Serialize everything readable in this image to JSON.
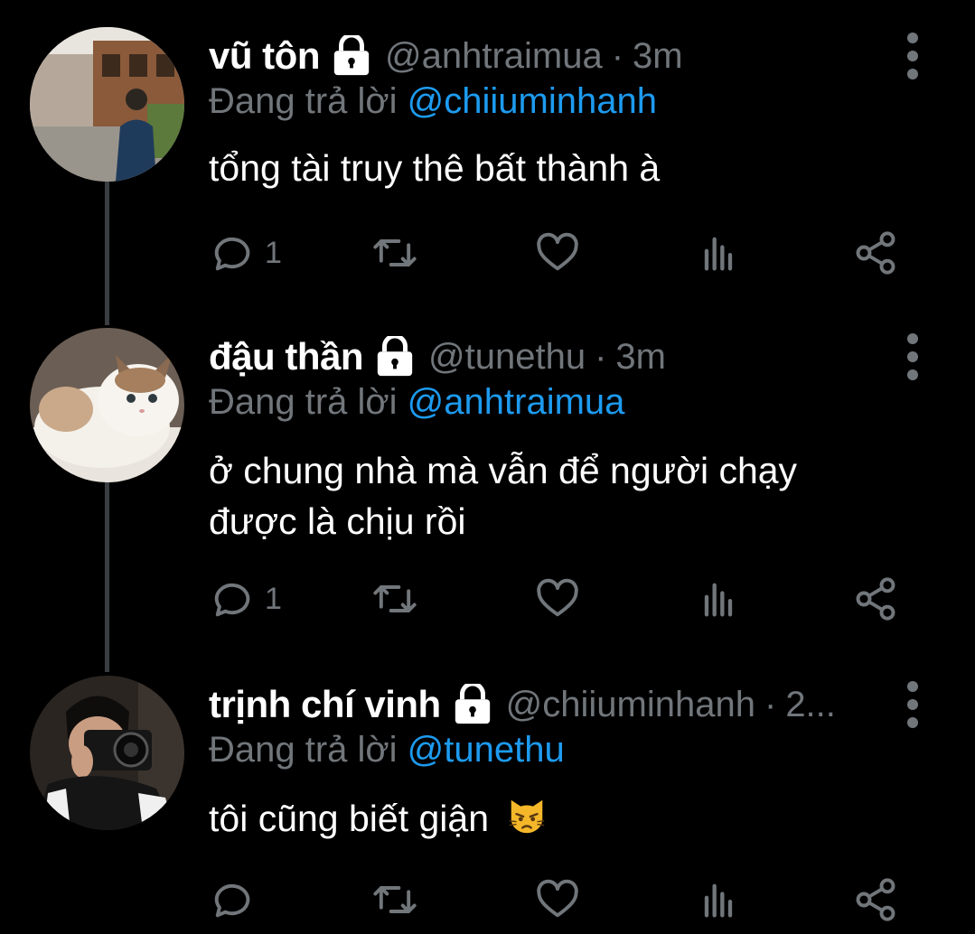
{
  "reply_prefix": "Đang trả lời",
  "tweets": [
    {
      "display_name": "vũ tôn",
      "handle": "@anhtraimua",
      "separator": "·",
      "time": "3m",
      "reply_to": "@chiiuminhanh",
      "text_lines": [
        "tổng tài truy thê bất thành à"
      ],
      "reply_count": "1",
      "avatar": "photo of a person in front of traditional wooden houses"
    },
    {
      "display_name": "đậu thần",
      "handle": "@tunethu",
      "separator": "·",
      "time": "3m",
      "reply_to": "@anhtraimua",
      "text_lines": [
        "ở chung nhà mà vẫn để người chạy",
        "được là chịu rồi"
      ],
      "reply_count": "1",
      "avatar": "photo of a fluffy white and brown cat"
    },
    {
      "display_name": "trịnh chí vinh",
      "handle": "@chiiuminhanh",
      "separator": "·",
      "time": "2...",
      "reply_to": "@tunethu",
      "text_lines": [
        "tôi cũng biết giận"
      ],
      "reply_count": "",
      "emoji": "pouting-cat-emoji",
      "avatar": "photo of a person holding a camera"
    }
  ],
  "icons": {
    "lock": "lock-icon",
    "more": "more-vertical-icon",
    "reply": "reply-icon",
    "retweet": "retweet-icon",
    "like": "heart-icon",
    "analytics": "analytics-icon",
    "share": "share-icon"
  },
  "colors": {
    "background": "#000000",
    "name": "#ffffff",
    "secondary": "#71767b",
    "mention": "#1d9bf0",
    "thread_line": "#3a3d41"
  }
}
